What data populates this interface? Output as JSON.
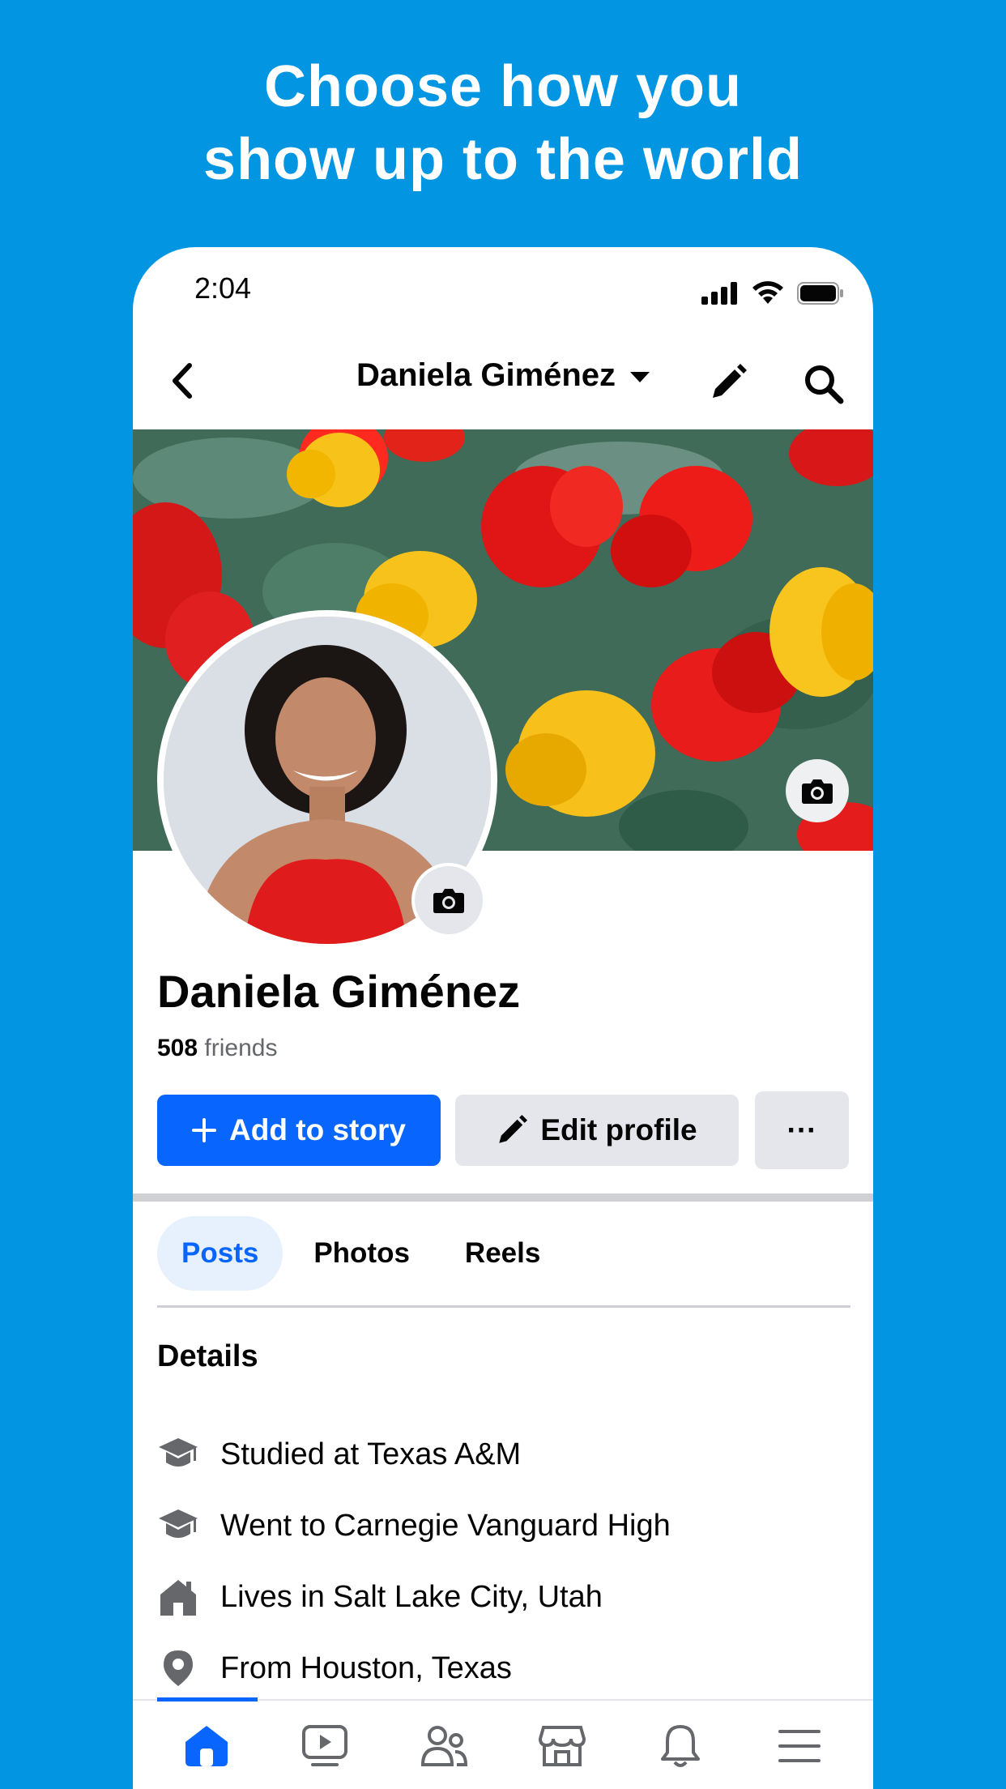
{
  "headline": {
    "line1": "Choose how you",
    "line2": "show up to the world"
  },
  "status_bar": {
    "time": "2:04",
    "icons": [
      "cellular-signal-icon",
      "wifi-icon",
      "battery-icon"
    ]
  },
  "nav": {
    "title": "Daniela Giménez",
    "back_icon": "chevron-left-icon",
    "edit_icon": "pencil-icon",
    "search_icon": "search-icon"
  },
  "profile": {
    "name": "Daniela Giménez",
    "friends_count": "508",
    "friends_label": "friends"
  },
  "actions": {
    "add_story": "Add to story",
    "edit_profile": "Edit profile",
    "more": "···"
  },
  "tabs": [
    {
      "label": "Posts",
      "active": true
    },
    {
      "label": "Photos",
      "active": false
    },
    {
      "label": "Reels",
      "active": false
    }
  ],
  "details": {
    "title": "Details",
    "items": [
      {
        "icon": "graduation-cap-icon",
        "prefix": "Studied at",
        "value": "Texas A&M"
      },
      {
        "icon": "graduation-cap-icon",
        "prefix": "Went to",
        "value": "Carnegie Vanguard High"
      },
      {
        "icon": "house-icon",
        "prefix": "Lives in",
        "value": "Salt Lake City, Utah"
      },
      {
        "icon": "location-pin-icon",
        "prefix": "From",
        "value": "Houston, Texas"
      }
    ]
  },
  "bottom_nav": [
    "home-icon",
    "video-icon",
    "friends-icon",
    "marketplace-icon",
    "notifications-icon",
    "menu-icon"
  ],
  "colors": {
    "background": "#0195e2",
    "accent": "#0866ff",
    "secondary_button": "#e4e6eb",
    "active_tab_bg": "#e7f0fd"
  }
}
